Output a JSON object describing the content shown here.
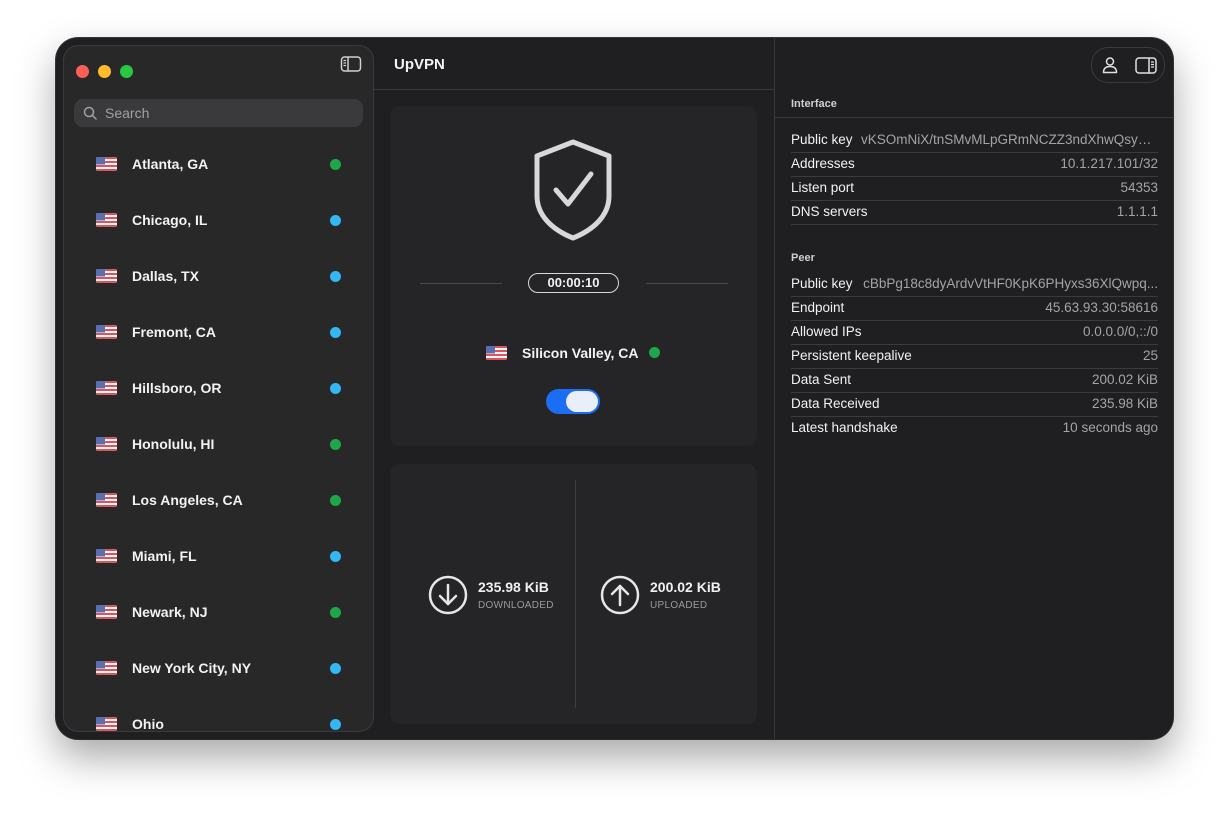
{
  "app": {
    "title": "UpVPN"
  },
  "search": {
    "placeholder": "Search"
  },
  "colors": {
    "online_green": "#1ea74a",
    "online_blue": "#33b7f4",
    "accent": "#1b6ef3"
  },
  "locations": [
    {
      "name": "Atlanta, GA",
      "status": "green"
    },
    {
      "name": "Chicago, IL",
      "status": "blue"
    },
    {
      "name": "Dallas, TX",
      "status": "blue"
    },
    {
      "name": "Fremont, CA",
      "status": "blue"
    },
    {
      "name": "Hillsboro, OR",
      "status": "blue"
    },
    {
      "name": "Honolulu, HI",
      "status": "green"
    },
    {
      "name": "Los Angeles, CA",
      "status": "green"
    },
    {
      "name": "Miami, FL",
      "status": "blue"
    },
    {
      "name": "Newark, NJ",
      "status": "green"
    },
    {
      "name": "New York City, NY",
      "status": "blue"
    },
    {
      "name": "Ohio",
      "status": "blue"
    }
  ],
  "connection": {
    "timer": "00:00:10",
    "location": "Silicon Valley, CA",
    "status": "green",
    "toggle_on": true
  },
  "stats": {
    "downloaded_value": "235.98 KiB",
    "downloaded_label": "DOWNLOADED",
    "uploaded_value": "200.02 KiB",
    "uploaded_label": "UPLOADED"
  },
  "interface": {
    "title": "Interface",
    "rows": [
      {
        "k": "Public key",
        "v": "vKSOmNiX/tnSMvMLpGRmNCZZ3ndXhwQsy4p..."
      },
      {
        "k": "Addresses",
        "v": "10.1.217.101/32"
      },
      {
        "k": "Listen port",
        "v": "54353"
      },
      {
        "k": "DNS servers",
        "v": "1.1.1.1"
      }
    ]
  },
  "peer": {
    "title": "Peer",
    "rows": [
      {
        "k": "Public key",
        "v": "cBbPg18c8dyArdvVtHF0KpK6PHyxs36XlQwpq..."
      },
      {
        "k": "Endpoint",
        "v": "45.63.93.30:58616"
      },
      {
        "k": "Allowed IPs",
        "v": "0.0.0.0/0,::/0"
      },
      {
        "k": "Persistent keepalive",
        "v": "25"
      },
      {
        "k": "Data Sent",
        "v": "200.02 KiB"
      },
      {
        "k": "Data Received",
        "v": "235.98 KiB"
      },
      {
        "k": "Latest handshake",
        "v": "10 seconds ago"
      }
    ]
  }
}
